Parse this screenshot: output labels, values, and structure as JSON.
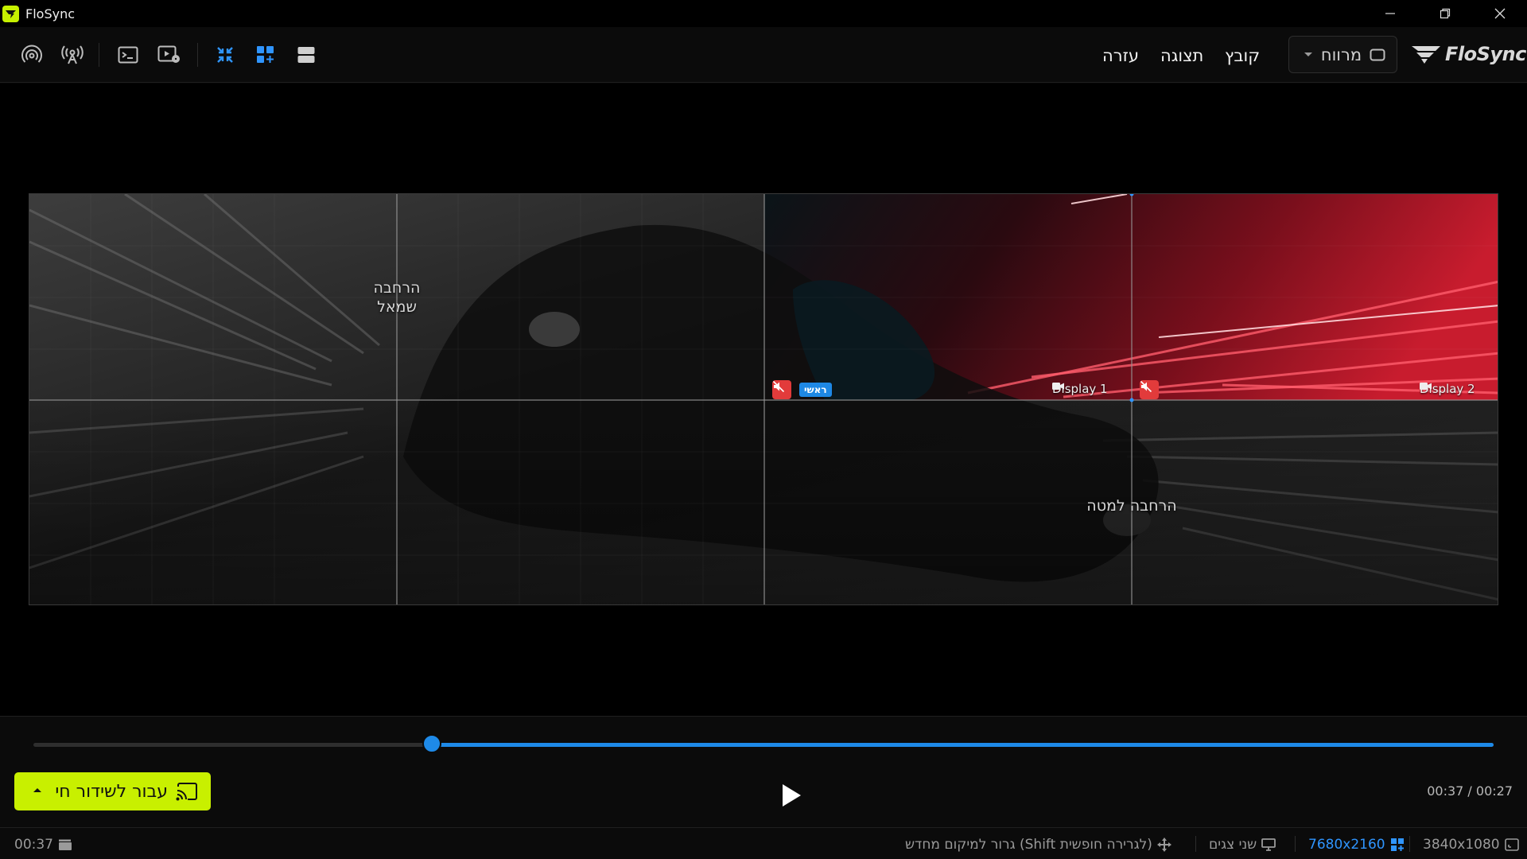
{
  "app": {
    "title": "FloSync",
    "brand": "FloSync"
  },
  "toolbar": {
    "menus": {
      "file": "קובץ",
      "view": "תצוגה",
      "help": "עזרה"
    },
    "space_select": {
      "label": "מרווח"
    }
  },
  "canvas": {
    "region_left": "הרחבה\nשמאל",
    "region_bottom": "הרחבה למטה",
    "display1": {
      "label": "Display 1",
      "badge_primary": "ראשי"
    },
    "display2": {
      "label": "Display 2"
    }
  },
  "playback": {
    "progress": 0.273,
    "timecode": "00:37 / 00:27",
    "live_button": "עבור לשידור חי"
  },
  "status": {
    "duration": "00:37",
    "drag_hint": "גרור למיקום מחדש (Shift לגרירה חופשית)",
    "displays": "שני צגים",
    "canvas_res": "7680x2160",
    "display_res": "3840x1080"
  },
  "colors": {
    "accent": "#c8f000",
    "blue": "#1e8ae8",
    "mute": "#e23b3b"
  }
}
